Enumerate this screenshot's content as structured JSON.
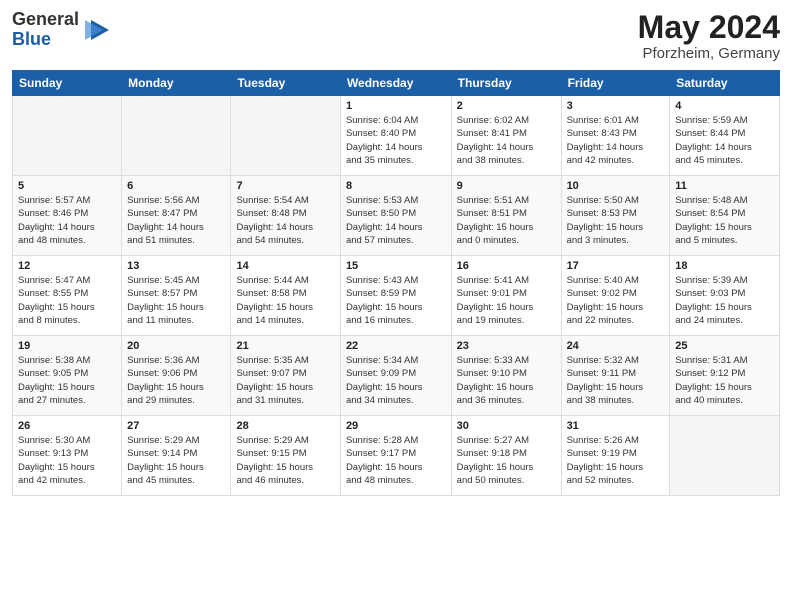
{
  "header": {
    "logo_general": "General",
    "logo_blue": "Blue",
    "month_title": "May 2024",
    "subtitle": "Pforzheim, Germany"
  },
  "weekdays": [
    "Sunday",
    "Monday",
    "Tuesday",
    "Wednesday",
    "Thursday",
    "Friday",
    "Saturday"
  ],
  "weeks": [
    [
      {
        "day": "",
        "info": ""
      },
      {
        "day": "",
        "info": ""
      },
      {
        "day": "",
        "info": ""
      },
      {
        "day": "1",
        "info": "Sunrise: 6:04 AM\nSunset: 8:40 PM\nDaylight: 14 hours\nand 35 minutes."
      },
      {
        "day": "2",
        "info": "Sunrise: 6:02 AM\nSunset: 8:41 PM\nDaylight: 14 hours\nand 38 minutes."
      },
      {
        "day": "3",
        "info": "Sunrise: 6:01 AM\nSunset: 8:43 PM\nDaylight: 14 hours\nand 42 minutes."
      },
      {
        "day": "4",
        "info": "Sunrise: 5:59 AM\nSunset: 8:44 PM\nDaylight: 14 hours\nand 45 minutes."
      }
    ],
    [
      {
        "day": "5",
        "info": "Sunrise: 5:57 AM\nSunset: 8:46 PM\nDaylight: 14 hours\nand 48 minutes."
      },
      {
        "day": "6",
        "info": "Sunrise: 5:56 AM\nSunset: 8:47 PM\nDaylight: 14 hours\nand 51 minutes."
      },
      {
        "day": "7",
        "info": "Sunrise: 5:54 AM\nSunset: 8:48 PM\nDaylight: 14 hours\nand 54 minutes."
      },
      {
        "day": "8",
        "info": "Sunrise: 5:53 AM\nSunset: 8:50 PM\nDaylight: 14 hours\nand 57 minutes."
      },
      {
        "day": "9",
        "info": "Sunrise: 5:51 AM\nSunset: 8:51 PM\nDaylight: 15 hours\nand 0 minutes."
      },
      {
        "day": "10",
        "info": "Sunrise: 5:50 AM\nSunset: 8:53 PM\nDaylight: 15 hours\nand 3 minutes."
      },
      {
        "day": "11",
        "info": "Sunrise: 5:48 AM\nSunset: 8:54 PM\nDaylight: 15 hours\nand 5 minutes."
      }
    ],
    [
      {
        "day": "12",
        "info": "Sunrise: 5:47 AM\nSunset: 8:55 PM\nDaylight: 15 hours\nand 8 minutes."
      },
      {
        "day": "13",
        "info": "Sunrise: 5:45 AM\nSunset: 8:57 PM\nDaylight: 15 hours\nand 11 minutes."
      },
      {
        "day": "14",
        "info": "Sunrise: 5:44 AM\nSunset: 8:58 PM\nDaylight: 15 hours\nand 14 minutes."
      },
      {
        "day": "15",
        "info": "Sunrise: 5:43 AM\nSunset: 8:59 PM\nDaylight: 15 hours\nand 16 minutes."
      },
      {
        "day": "16",
        "info": "Sunrise: 5:41 AM\nSunset: 9:01 PM\nDaylight: 15 hours\nand 19 minutes."
      },
      {
        "day": "17",
        "info": "Sunrise: 5:40 AM\nSunset: 9:02 PM\nDaylight: 15 hours\nand 22 minutes."
      },
      {
        "day": "18",
        "info": "Sunrise: 5:39 AM\nSunset: 9:03 PM\nDaylight: 15 hours\nand 24 minutes."
      }
    ],
    [
      {
        "day": "19",
        "info": "Sunrise: 5:38 AM\nSunset: 9:05 PM\nDaylight: 15 hours\nand 27 minutes."
      },
      {
        "day": "20",
        "info": "Sunrise: 5:36 AM\nSunset: 9:06 PM\nDaylight: 15 hours\nand 29 minutes."
      },
      {
        "day": "21",
        "info": "Sunrise: 5:35 AM\nSunset: 9:07 PM\nDaylight: 15 hours\nand 31 minutes."
      },
      {
        "day": "22",
        "info": "Sunrise: 5:34 AM\nSunset: 9:09 PM\nDaylight: 15 hours\nand 34 minutes."
      },
      {
        "day": "23",
        "info": "Sunrise: 5:33 AM\nSunset: 9:10 PM\nDaylight: 15 hours\nand 36 minutes."
      },
      {
        "day": "24",
        "info": "Sunrise: 5:32 AM\nSunset: 9:11 PM\nDaylight: 15 hours\nand 38 minutes."
      },
      {
        "day": "25",
        "info": "Sunrise: 5:31 AM\nSunset: 9:12 PM\nDaylight: 15 hours\nand 40 minutes."
      }
    ],
    [
      {
        "day": "26",
        "info": "Sunrise: 5:30 AM\nSunset: 9:13 PM\nDaylight: 15 hours\nand 42 minutes."
      },
      {
        "day": "27",
        "info": "Sunrise: 5:29 AM\nSunset: 9:14 PM\nDaylight: 15 hours\nand 45 minutes."
      },
      {
        "day": "28",
        "info": "Sunrise: 5:29 AM\nSunset: 9:15 PM\nDaylight: 15 hours\nand 46 minutes."
      },
      {
        "day": "29",
        "info": "Sunrise: 5:28 AM\nSunset: 9:17 PM\nDaylight: 15 hours\nand 48 minutes."
      },
      {
        "day": "30",
        "info": "Sunrise: 5:27 AM\nSunset: 9:18 PM\nDaylight: 15 hours\nand 50 minutes."
      },
      {
        "day": "31",
        "info": "Sunrise: 5:26 AM\nSunset: 9:19 PM\nDaylight: 15 hours\nand 52 minutes."
      },
      {
        "day": "",
        "info": ""
      }
    ]
  ]
}
